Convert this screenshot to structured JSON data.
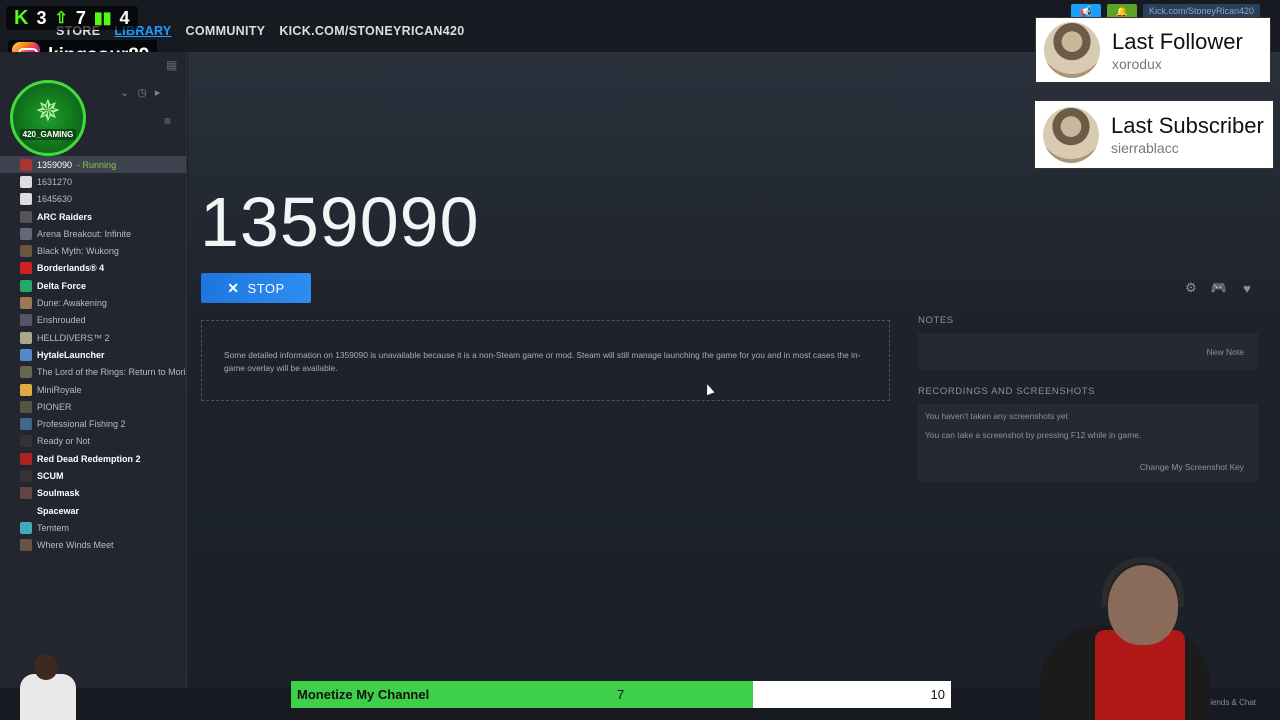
{
  "nav": {
    "links": [
      "STORE",
      "LIBRARY",
      "COMMUNITY",
      "KICK.COM/STONEYRICAN420"
    ],
    "active": "LIBRARY",
    "account": "Kick.com/StoneyRican420"
  },
  "stream_stats": {
    "kick_count": "3",
    "followers_count": "7",
    "viewers_count": "4"
  },
  "instagram": {
    "handle": "kingsour89"
  },
  "logo": {
    "text": "420_GAMING"
  },
  "sidebar": {
    "games": [
      {
        "name": "1359090",
        "status": " - Running",
        "selected": true,
        "bold": false,
        "color": "#a33"
      },
      {
        "name": "1631270",
        "bold": false,
        "color": "#ddd"
      },
      {
        "name": "1645630",
        "bold": false,
        "color": "#ddd"
      },
      {
        "name": "ARC Raiders",
        "bold": true,
        "color": "#555"
      },
      {
        "name": "Arena Breakout: Infinite",
        "bold": false,
        "color": "#667"
      },
      {
        "name": "Black Myth: Wukong",
        "bold": false,
        "color": "#6a5540"
      },
      {
        "name": "Borderlands® 4",
        "bold": true,
        "color": "#c22"
      },
      {
        "name": "Delta Force",
        "bold": true,
        "color": "#2a6"
      },
      {
        "name": "Dune: Awakening",
        "bold": false,
        "color": "#9a7a50"
      },
      {
        "name": "Enshrouded",
        "bold": false,
        "color": "#556"
      },
      {
        "name": "HELLDIVERS™ 2",
        "bold": false,
        "color": "#aa8"
      },
      {
        "name": "HytaleLauncher",
        "bold": true,
        "color": "#58c"
      },
      {
        "name": "The Lord of the Rings: Return to Mori",
        "bold": false,
        "color": "#665"
      },
      {
        "name": "MiniRoyale",
        "bold": false,
        "color": "#da4"
      },
      {
        "name": "PIONER",
        "bold": false,
        "color": "#554"
      },
      {
        "name": "Professional Fishing 2",
        "bold": false,
        "color": "#468"
      },
      {
        "name": "Ready or Not",
        "bold": false,
        "color": "#333"
      },
      {
        "name": "Red Dead Redemption 2",
        "bold": true,
        "color": "#a22"
      },
      {
        "name": "SCUM",
        "bold": true,
        "color": "#333"
      },
      {
        "name": "Soulmask",
        "bold": true,
        "color": "#644"
      },
      {
        "name": "Spacewar",
        "bold": true,
        "color": "#23262e"
      },
      {
        "name": "Temtem",
        "bold": false,
        "color": "#4ab"
      },
      {
        "name": "Where Winds Meet",
        "bold": false,
        "color": "#654"
      }
    ]
  },
  "main": {
    "game_title": "1359090",
    "stop_label": "STOP",
    "info_text": "Some detailed information on 1359090 is unavailable because it is a non-Steam game or mod. Steam will still manage launching the game for you and in most cases the in-game overlay will be available.",
    "notes_heading": "NOTES",
    "new_note_label": "New Note",
    "recordings_heading": "RECORDINGS AND SCREENSHOTS",
    "no_screenshots": "You haven't taken any screenshots yet",
    "screenshot_hint": "You can take a screenshot by pressing F12 while in game.",
    "change_key_link": "Change My Screenshot Key"
  },
  "alerts": {
    "last_follower": {
      "label": "Last Follower",
      "name": "xorodux"
    },
    "last_subscriber": {
      "label": "Last Subscriber",
      "name": "sierrablacc"
    }
  },
  "goal": {
    "label": "Monetize My Channel",
    "current": 7,
    "target": 10,
    "current_text": "7",
    "target_text": "10",
    "fill_color": "#3fd04a"
  },
  "footer": {
    "friends_chat": "iends & Chat"
  }
}
